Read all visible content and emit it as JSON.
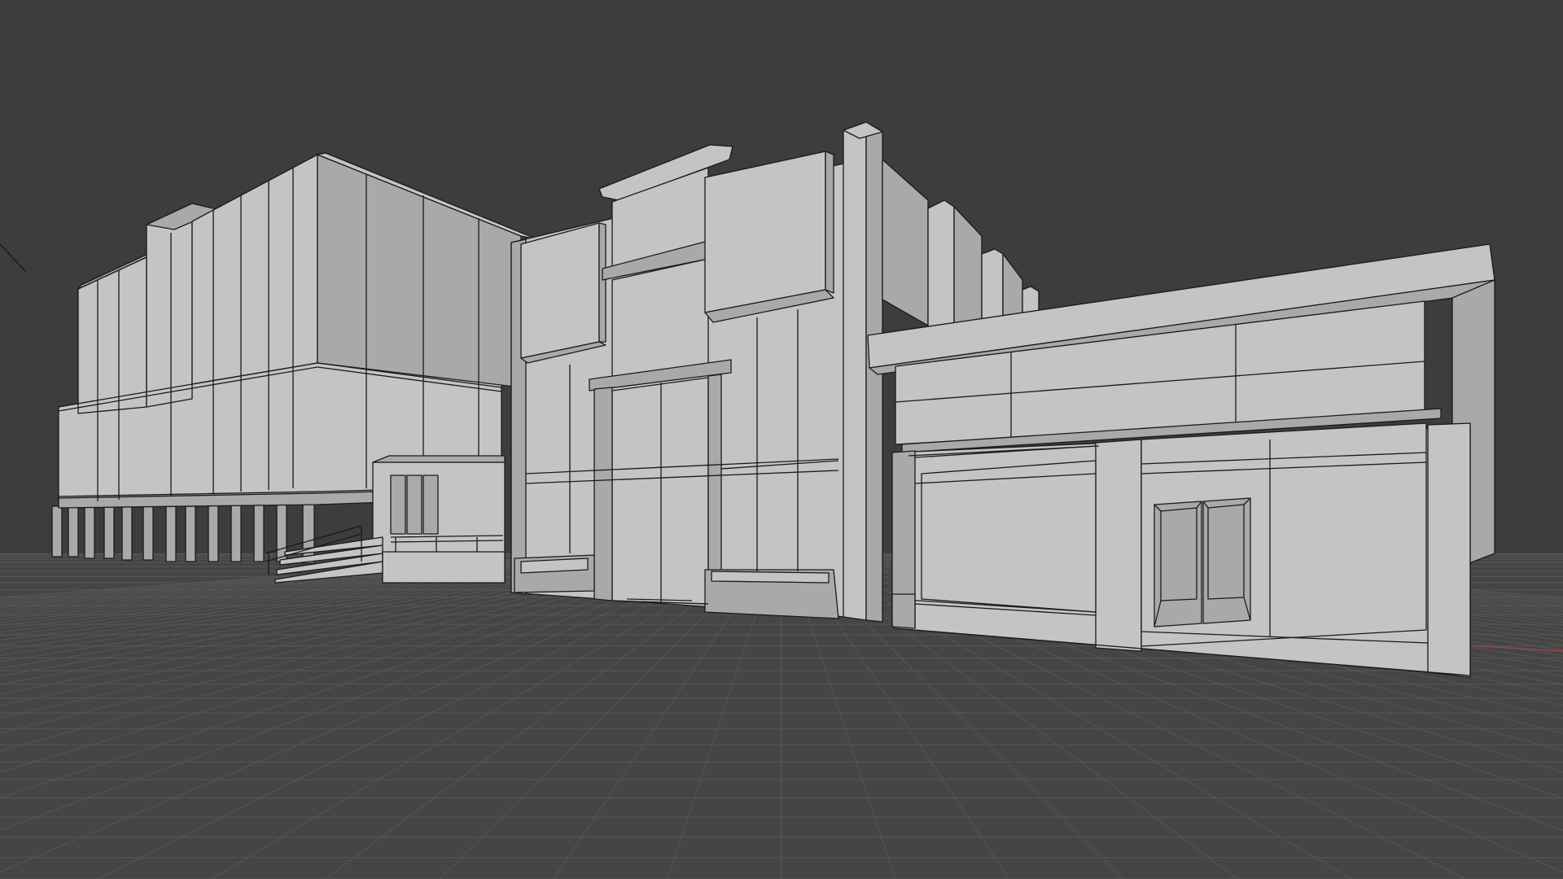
{
  "viewport": {
    "background_color": "#3d3d3d",
    "grid_color": "#4a4a4a",
    "grid_line_color": "#5a5a5a",
    "axis_x_color": "#c94a4a",
    "mesh_face_color": "#c4c4c4",
    "mesh_edge_color": "#1a1a1a"
  },
  "scene": {
    "objects": [
      "left-building-block",
      "middle-building-facade",
      "tall-pillar",
      "right-storefront",
      "entrance-stairs",
      "ground-plane"
    ]
  }
}
